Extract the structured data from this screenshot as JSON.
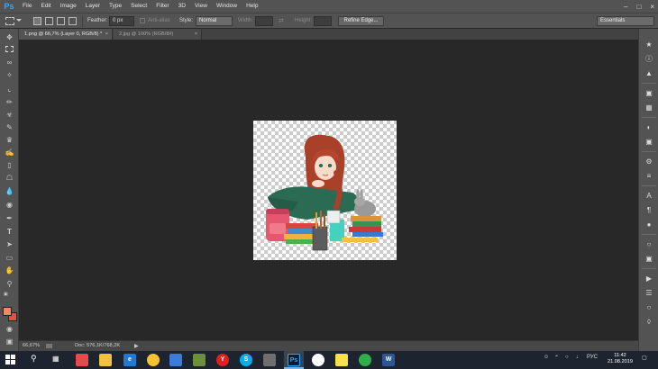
{
  "app": {
    "logo": "Ps"
  },
  "menu": [
    "File",
    "Edit",
    "Image",
    "Layer",
    "Type",
    "Select",
    "Filter",
    "3D",
    "View",
    "Window",
    "Help"
  ],
  "options": {
    "feather_label": "Feather:",
    "feather_value": "0 px",
    "antialias_label": "Anti-alias",
    "style_label": "Style:",
    "style_value": "Normal",
    "width_label": "Width:",
    "height_label": "Height:",
    "refine_edge": "Refine Edge...",
    "workspace_value": "Essentials"
  },
  "tabs": [
    {
      "label": "1.png @ 66,7% (Layer 0, RGB/8) *",
      "active": true
    },
    {
      "label": "2.jpg @ 100% (RGB/8#)",
      "active": false
    }
  ],
  "status": {
    "zoom": "66,67%",
    "doc": "Doc: 576,1K/768,2K"
  },
  "colors": {
    "foreground": "#ef8a66",
    "background": "#e9503c",
    "accent": "#31a8ff"
  },
  "toolbar_icons": [
    "move-icon",
    "marquee-icon",
    "lasso-icon",
    "magic-wand-icon",
    "crop-icon",
    "eyedropper-icon",
    "spot-healing-icon",
    "brush-icon",
    "clone-stamp-icon",
    "history-brush-icon",
    "eraser-icon",
    "paint-bucket-icon",
    "blur-icon",
    "dodge-icon",
    "pen-icon",
    "type-icon",
    "path-selection-icon",
    "rectangle-shape-icon",
    "hand-icon",
    "zoom-icon"
  ],
  "taskbar": {
    "clock_time": "11:42",
    "clock_date": "21.08.2019",
    "language": "РУС"
  }
}
